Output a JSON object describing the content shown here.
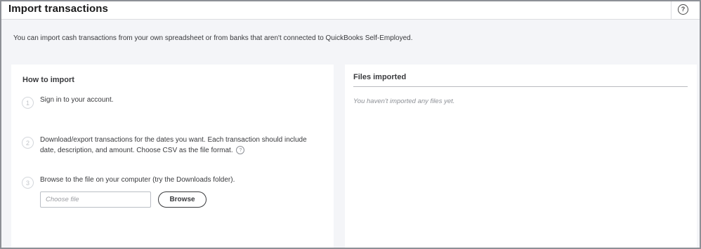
{
  "header": {
    "title": "Import transactions",
    "help_icon_glyph": "?"
  },
  "intro_text": "You can import cash transactions from your own spreadsheet or from banks that aren't connected to QuickBooks Self-Employed.",
  "how_to": {
    "heading": "How to import",
    "steps": [
      {
        "number": "1",
        "text": "Sign in to your account."
      },
      {
        "number": "2",
        "text": "Download/export transactions for the dates you want. Each transaction should include date, description, and amount. Choose CSV as the file format.",
        "tip_glyph": "?"
      },
      {
        "number": "3",
        "text": "Browse to the file on your computer (try the Downloads folder)."
      }
    ],
    "file_input": {
      "value": "",
      "placeholder": "Choose file"
    },
    "browse_label": "Browse"
  },
  "files_imported": {
    "heading": "Files imported",
    "empty_message": "You haven't imported any files yet."
  },
  "icons": {
    "help": "question-circle-icon",
    "tip": "question-circle-icon"
  },
  "colors": {
    "background": "#f4f5f8",
    "text": "#393a3d",
    "muted": "#8d9096"
  }
}
